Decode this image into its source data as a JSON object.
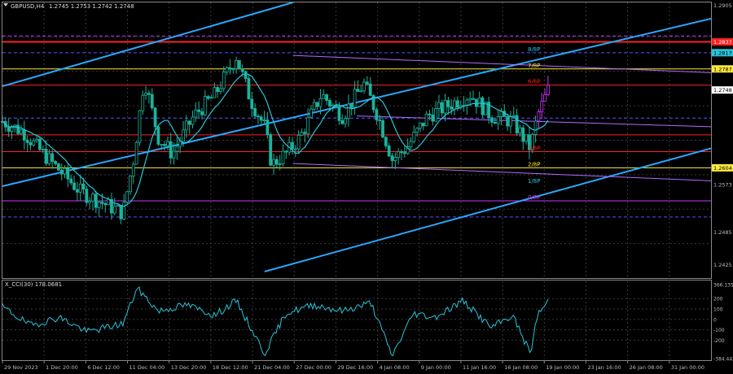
{
  "header": {
    "symbol": "GBPUSD,H4",
    "quote": "1.2745 1.2753 1.2742 1.2748"
  },
  "indicator": {
    "title": "X_CCI(30) 178.0681",
    "ticks": [
      "366.1356",
      "200",
      "100",
      "0",
      "-100",
      "-200",
      "-384.4420"
    ]
  },
  "price_axis": {
    "labels": [
      "1.2905",
      "1.2787",
      "1.2748",
      "1.2604",
      "1.2573",
      "1.2485",
      "1.2425"
    ]
  },
  "level_tags": [
    {
      "text": "1.2837",
      "color": "#ff1f1f",
      "price": 1.2837
    },
    {
      "text": "1.2817",
      "color": "#26c6da",
      "price": 1.2817
    },
    {
      "text": "1.2787",
      "color": "#ffeb3b",
      "price": 1.2787
    },
    {
      "text": "1.2748",
      "color": "#ffffff",
      "price": 1.2748
    },
    {
      "text": "1.2604",
      "color": "#ffeb3b",
      "price": 1.2604
    }
  ],
  "murrey_labels": [
    {
      "text": "8/8P",
      "color": "#26c6da",
      "price": 1.2817
    },
    {
      "text": "7/8P",
      "color": "#ffeb3b",
      "price": 1.2787
    },
    {
      "text": "6/8P",
      "color": "#ff1f1f",
      "price": 1.2757
    },
    {
      "text": "3/8P",
      "color": "#ff1f1f",
      "price": 1.2634
    },
    {
      "text": "2/8P",
      "color": "#ffeb3b",
      "price": 1.2604
    },
    {
      "text": "1/8P",
      "color": "#26c6da",
      "price": 1.2573
    },
    {
      "text": "0/8P",
      "color": "#cc33ff",
      "price": 1.2543
    }
  ],
  "time_axis": {
    "labels": [
      "29 Nov 2023",
      "1 Dec 20:00",
      "6 Dec 12:00",
      "11 Dec 04:00",
      "13 Dec 20:00",
      "18 Dec 12:00",
      "21 Dec 04:00",
      "27 Dec 00:00",
      "29 Dec 16:00",
      "4 Jan 08:00",
      "9 Jan 00:00",
      "11 Jan 16:00",
      "16 Jan 08:00",
      "19 Jan 00:00",
      "23 Jan 16:00",
      "26 Jan 08:00",
      "31 Jan 00:00"
    ]
  },
  "colors": {
    "background": "#000000",
    "bull": "#1ab39c",
    "bear": "#1ab39c",
    "bull_recent": "#cc33ff",
    "ma": "#26c6da",
    "channel": "#29a8ff",
    "purple": "#b36bff",
    "red": "#ff1f1f",
    "yellow": "#ffeb3b",
    "cci": "#26c6da"
  },
  "chart_data": {
    "type": "candlestick",
    "price_range": [
      1.24,
      1.291
    ],
    "cci_range": [
      -384.442,
      366.1356
    ],
    "close_path": [
      {
        "x": 0.0,
        "p": 1.269
      },
      {
        "x": 0.03,
        "p": 1.267
      },
      {
        "x": 0.05,
        "p": 1.264
      },
      {
        "x": 0.08,
        "p": 1.26
      },
      {
        "x": 0.11,
        "p": 1.256
      },
      {
        "x": 0.14,
        "p": 1.254
      },
      {
        "x": 0.17,
        "p": 1.252
      },
      {
        "x": 0.185,
        "p": 1.262
      },
      {
        "x": 0.2,
        "p": 1.277
      },
      {
        "x": 0.22,
        "p": 1.266
      },
      {
        "x": 0.24,
        "p": 1.263
      },
      {
        "x": 0.27,
        "p": 1.27
      },
      {
        "x": 0.3,
        "p": 1.274
      },
      {
        "x": 0.33,
        "p": 1.281
      },
      {
        "x": 0.35,
        "p": 1.273
      },
      {
        "x": 0.37,
        "p": 1.268
      },
      {
        "x": 0.38,
        "p": 1.261
      },
      {
        "x": 0.4,
        "p": 1.263
      },
      {
        "x": 0.42,
        "p": 1.266
      },
      {
        "x": 0.45,
        "p": 1.274
      },
      {
        "x": 0.48,
        "p": 1.27
      },
      {
        "x": 0.51,
        "p": 1.276
      },
      {
        "x": 0.53,
        "p": 1.27
      },
      {
        "x": 0.55,
        "p": 1.262
      },
      {
        "x": 0.57,
        "p": 1.264
      },
      {
        "x": 0.6,
        "p": 1.27
      },
      {
        "x": 0.63,
        "p": 1.272
      },
      {
        "x": 0.66,
        "p": 1.274
      },
      {
        "x": 0.69,
        "p": 1.27
      },
      {
        "x": 0.72,
        "p": 1.269
      },
      {
        "x": 0.745,
        "p": 1.264
      },
      {
        "x": 0.755,
        "p": 1.27
      },
      {
        "x": 0.77,
        "p": 1.2748
      }
    ],
    "cci_path": [
      {
        "x": 0.0,
        "v": 120
      },
      {
        "x": 0.04,
        "v": -60
      },
      {
        "x": 0.08,
        "v": 20
      },
      {
        "x": 0.12,
        "v": -120
      },
      {
        "x": 0.17,
        "v": -40
      },
      {
        "x": 0.19,
        "v": 300
      },
      {
        "x": 0.22,
        "v": 80
      },
      {
        "x": 0.26,
        "v": 140
      },
      {
        "x": 0.3,
        "v": 40
      },
      {
        "x": 0.33,
        "v": 180
      },
      {
        "x": 0.37,
        "v": -330
      },
      {
        "x": 0.4,
        "v": 60
      },
      {
        "x": 0.44,
        "v": 140
      },
      {
        "x": 0.48,
        "v": 80
      },
      {
        "x": 0.52,
        "v": 160
      },
      {
        "x": 0.55,
        "v": -350
      },
      {
        "x": 0.58,
        "v": 60
      },
      {
        "x": 0.61,
        "v": 20
      },
      {
        "x": 0.65,
        "v": 180
      },
      {
        "x": 0.69,
        "v": -80
      },
      {
        "x": 0.72,
        "v": 40
      },
      {
        "x": 0.745,
        "v": -330
      },
      {
        "x": 0.755,
        "v": 40
      },
      {
        "x": 0.77,
        "v": 178
      }
    ],
    "horizontal_levels": [
      {
        "price": 1.2837,
        "color": "#ff1f1f",
        "style": "solid",
        "width": 2
      },
      {
        "price": 1.2787,
        "color": "#ffeb3b",
        "style": "solid",
        "width": 1
      },
      {
        "price": 1.2757,
        "color": "#ff1f1f",
        "style": "solid",
        "width": 1
      },
      {
        "price": 1.2665,
        "color": "#ff1f1f",
        "style": "solid",
        "width": 1
      },
      {
        "price": 1.2634,
        "color": "#ff1f1f",
        "style": "solid",
        "width": 1
      },
      {
        "price": 1.2604,
        "color": "#ffeb3b",
        "style": "solid",
        "width": 1
      },
      {
        "price": 1.2543,
        "color": "#cc33ff",
        "style": "solid",
        "width": 1
      },
      {
        "price": 1.2848,
        "color": "#cc33ff",
        "style": "dashed",
        "width": 1
      },
      {
        "price": 1.2817,
        "color": "#5555ff",
        "style": "dashed",
        "width": 1
      },
      {
        "price": 1.2696,
        "color": "#5555ff",
        "style": "dashed",
        "width": 1
      },
      {
        "price": 1.2513,
        "color": "#5555ff",
        "style": "dashed",
        "width": 1
      }
    ],
    "trend_lines": [
      {
        "x1": 0.0,
        "p1": 1.2755,
        "x2": 0.41,
        "p2": 1.291,
        "color": "#29a8ff",
        "width": 2
      },
      {
        "x1": 0.0,
        "p1": 1.257,
        "x2": 1.0,
        "p2": 1.288,
        "color": "#29a8ff",
        "width": 2
      },
      {
        "x1": 0.37,
        "p1": 1.2412,
        "x2": 1.0,
        "p2": 1.264,
        "color": "#29a8ff",
        "width": 2
      },
      {
        "x1": 0.41,
        "p1": 1.2812,
        "x2": 1.0,
        "p2": 1.278,
        "color": "#b36bff",
        "width": 1
      },
      {
        "x1": 0.41,
        "p1": 1.2612,
        "x2": 1.0,
        "p2": 1.258,
        "color": "#b36bff",
        "width": 1
      },
      {
        "x1": 0.5,
        "p1": 1.27,
        "x2": 1.0,
        "p2": 1.268,
        "color": "#b36bff",
        "width": 1
      }
    ]
  }
}
